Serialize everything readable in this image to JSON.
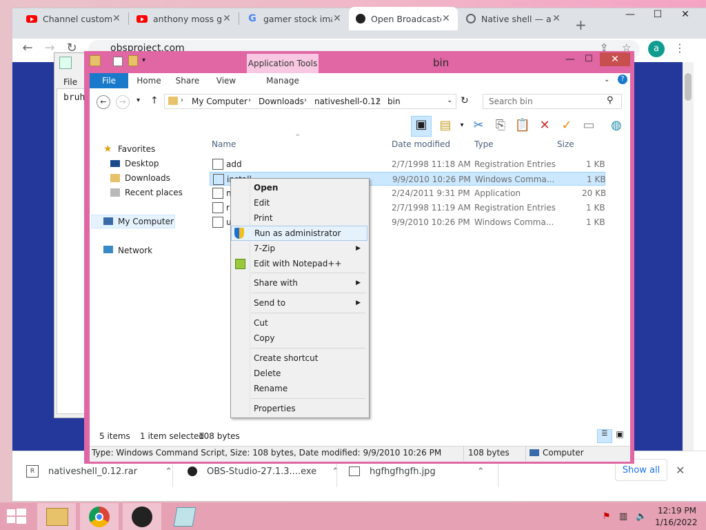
{
  "browser": {
    "tabs": [
      {
        "title": "Channel customiz",
        "icon": "youtube-icon"
      },
      {
        "title": "anthony moss gar",
        "icon": "youtube-icon"
      },
      {
        "title": "gamer stock imag",
        "icon": "google-icon"
      },
      {
        "title": "Open Broadcaste",
        "icon": "obs-icon",
        "active": true
      },
      {
        "title": "Native shell — a",
        "icon": "globe-icon"
      }
    ],
    "url": "obsproject.com",
    "avatar": "a",
    "downloads": [
      {
        "name": "nativeshell_0.12.rar"
      },
      {
        "name": "OBS-Studio-27.1.3....exe"
      },
      {
        "name": "hgfhgfhgfh.jpg"
      }
    ],
    "show_all": "Show all"
  },
  "notepad": {
    "menu": "File",
    "text": "bruh"
  },
  "explorer": {
    "title": "bin",
    "app_tools": "Application Tools",
    "ribbon_tabs": [
      "File",
      "Home",
      "Share",
      "View",
      "Manage"
    ],
    "breadcrumb": [
      "My Computer",
      "Downloads",
      "nativeshell-0.12",
      "bin"
    ],
    "search_placeholder": "Search bin",
    "nav": {
      "favorites": "Favorites",
      "desktop": "Desktop",
      "downloads": "Downloads",
      "recent": "Recent places",
      "computer": "My Computer",
      "network": "Network"
    },
    "columns": [
      "Name",
      "Date modified",
      "Type",
      "Size"
    ],
    "files": [
      {
        "name": "add",
        "date": "2/7/1998 11:18 AM",
        "type": "Registration Entries",
        "size": "1 KB"
      },
      {
        "name": "install",
        "date": "9/9/2010 10:26 PM",
        "type": "Windows Comma...",
        "size": "1 KB",
        "selected": true
      },
      {
        "name": "n",
        "date": "2/24/2011 9:31 PM",
        "type": "Application",
        "size": "20 KB"
      },
      {
        "name": "r",
        "date": "2/7/1998 11:19 AM",
        "type": "Registration Entries",
        "size": "1 KB"
      },
      {
        "name": "u",
        "date": "9/9/2010 10:26 PM",
        "type": "Windows Comma...",
        "size": "1 KB"
      }
    ],
    "status": {
      "items": "5 items",
      "selected": "1 item selected",
      "bytes": "108 bytes"
    },
    "details": "Type: Windows Command Script, Size: 108 bytes, Date modified: 9/9/2010 10:26 PM",
    "details_size": "108 bytes",
    "details_location": "Computer"
  },
  "context_menu": {
    "items": [
      "Open",
      "Edit",
      "Print",
      "Run as administrator",
      "7-Zip",
      "Edit with Notepad++",
      "Share with",
      "Send to",
      "Cut",
      "Copy",
      "Create shortcut",
      "Delete",
      "Rename",
      "Properties"
    ]
  },
  "taskbar": {
    "time": "12:19 PM",
    "date": "1/16/2022"
  }
}
